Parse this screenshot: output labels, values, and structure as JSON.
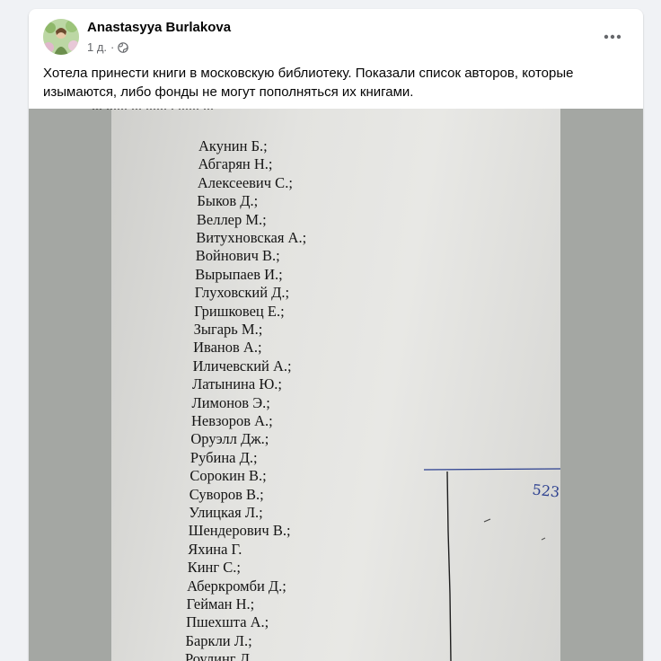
{
  "post": {
    "author_name": "Anastasyya Burlakova",
    "time": "1 д.",
    "separator": "·",
    "privacy_icon": "globe-icon",
    "more_icon": "more-options-icon",
    "caption": "Хотела принести книги в московскую библиотеку. Показали список авторов, которые изымаются, либо фонды не могут пополняться их книгами."
  },
  "photo": {
    "header_fragment": "... ...... ... ...... . ...... ...",
    "authors": [
      "Акунин Б.;",
      "Абгарян Н.;",
      "Алексеевич С.;",
      "Быков Д.;",
      "Веллер М.;",
      "Витухновская А.;",
      "Войнович В.;",
      "Вырыпаев И.;",
      "Глуховский Д.;",
      "Гришковец Е.;",
      "Зыгарь М.;",
      "Иванов А.;",
      "Иличевский А.;",
      "Латынина Ю.;",
      "Лимонов Э.;",
      "Невзоров А.;",
      "Оруэлл Дж.;",
      "Рубина Д.;",
      "Сорокин В.;",
      "Суворов В.;",
      "Улицкая Л.;",
      "Шендерович В.;",
      "Яхина Г.",
      "Кинг С.;",
      "Аберкромби Д.;",
      "Гейман Н.;",
      "Пшехшта А.;",
      "Баркли Л.;",
      "Роулинг Д."
    ],
    "handwritten_note": "523"
  },
  "colors": {
    "page_bg": "#f0f2f5",
    "card_bg": "#ffffff",
    "text_primary": "#050505",
    "text_secondary": "#65676b",
    "paper": "#e3e3e0",
    "ink_blue": "#2b3f8f"
  }
}
